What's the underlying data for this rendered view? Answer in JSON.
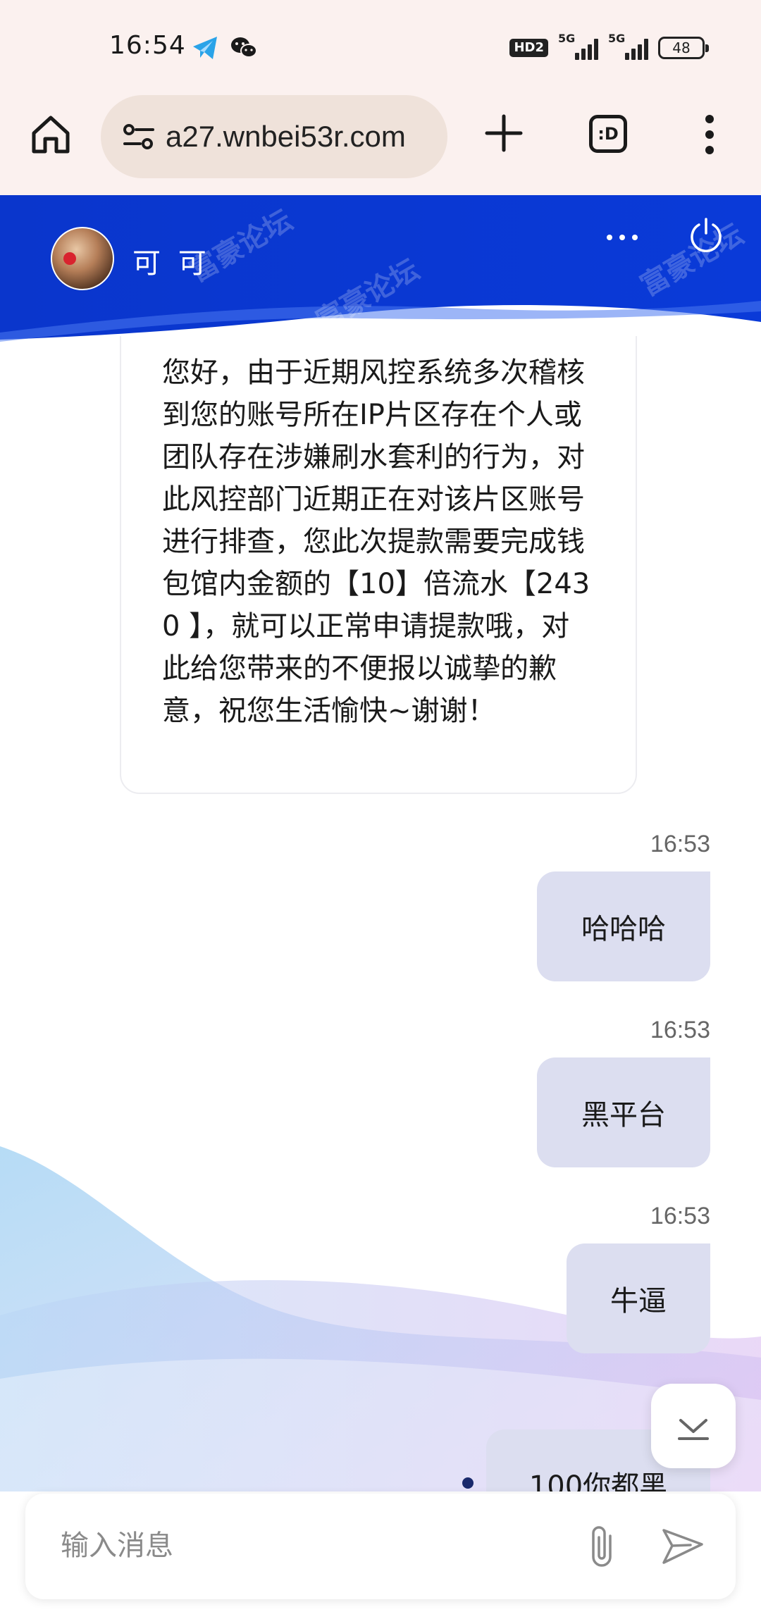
{
  "status_bar": {
    "time": "16:54",
    "hd_badge": "HD2",
    "network_1": "5G",
    "network_2": "5G",
    "battery": "48"
  },
  "browser": {
    "url": "a27.wnbei53r.com",
    "tabs_label": ":D"
  },
  "chat": {
    "contact_name": "可 可",
    "incoming_message": "您好，由于近期风控系统多次稽核到您的账号所在IP片区存在个人或团队存在涉嫌刷水套利的行为，对此风控部门近期正在对该片区账号进行排查，您此次提款需要完成钱包馆内金额的【10】倍流水【2430 】，就可以正常申请提款哦，对此给您带来的不便报以诚挚的歉意，祝您生活愉快~谢谢！",
    "outgoing": [
      {
        "time": "16:53",
        "text": "哈哈哈"
      },
      {
        "time": "16:53",
        "text": "黑平台"
      },
      {
        "time": "16:53",
        "text": "牛逼"
      },
      {
        "time": "",
        "text": "100你都黑"
      }
    ]
  },
  "input": {
    "placeholder": "输入消息"
  },
  "colors": {
    "header_blue": "#0a3bd6",
    "bubble_out": "#dcdef0",
    "status_bg": "#fbf1ef"
  }
}
